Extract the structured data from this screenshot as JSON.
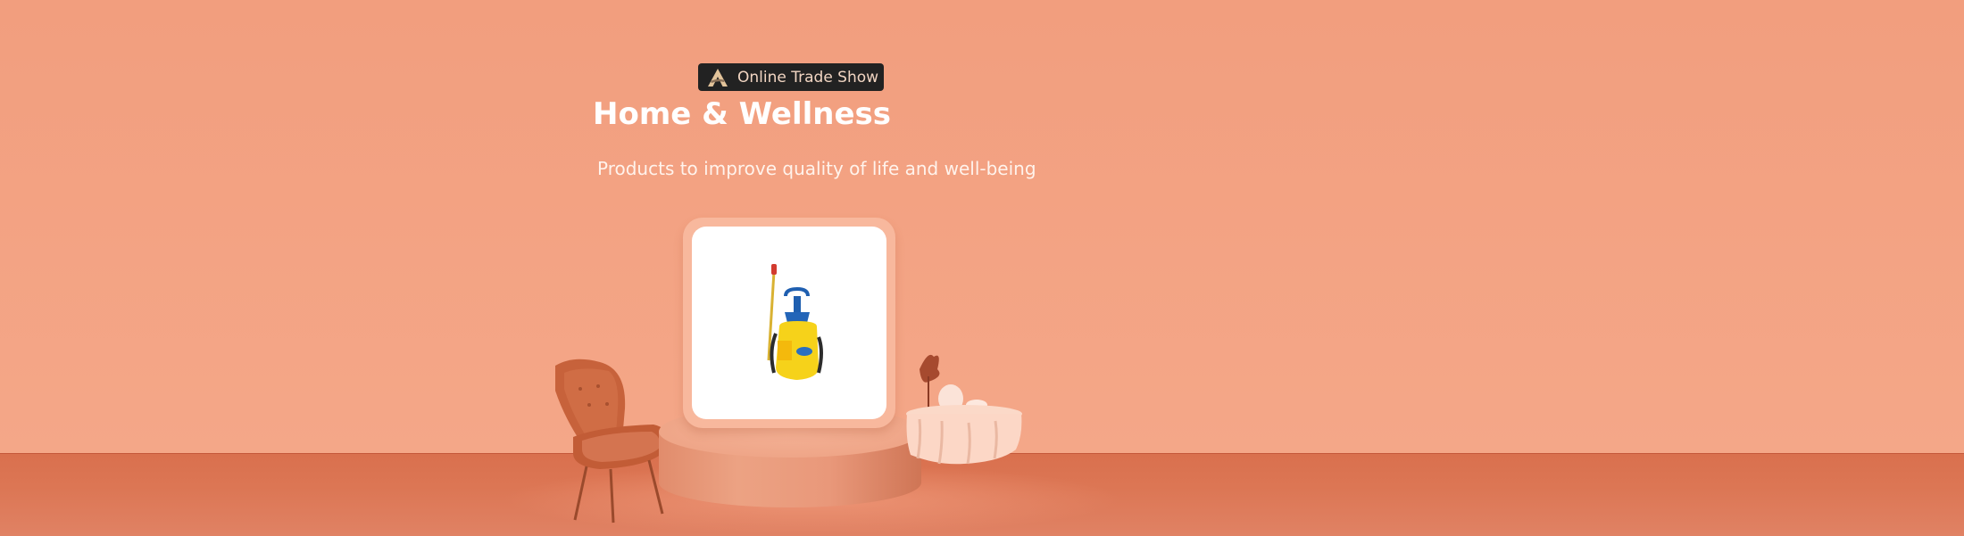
{
  "banner": {
    "badge_text": "Online Trade Show",
    "title": "Home & Wellness",
    "subtitle": "Products to improve quality of life and well-being"
  },
  "colors": {
    "wall": "#f29f7f",
    "floor": "#d9704e",
    "badge_bg": "#222222",
    "title_text": "#ffffff"
  },
  "icons": {
    "badge_logo": "alibaba-a-logo-icon",
    "product": "pressure-sprayer-product-image",
    "chair": "armchair-decoration",
    "table": "dining-table-decoration"
  }
}
